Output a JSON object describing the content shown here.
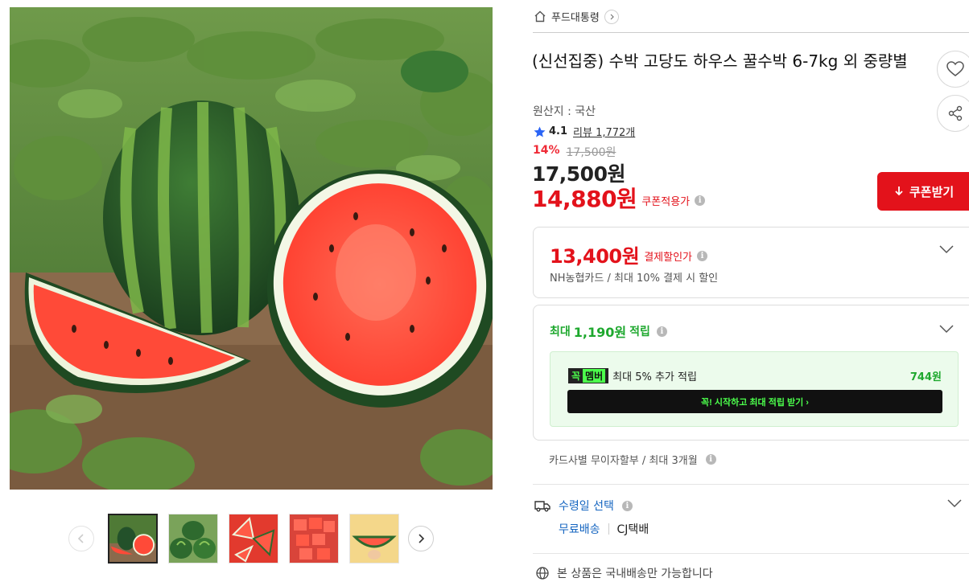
{
  "breadcrumb": {
    "category": "푸드대통령"
  },
  "product": {
    "title": "(신선집중) 수박 고당도 하우스 꿀수박 6-7kg 외 중량별",
    "origin": "원산지 : 국산",
    "rating": "4.1",
    "reviews": "리뷰 1,772개"
  },
  "price": {
    "discount_rate": "14%",
    "original": "17,500원",
    "sale": "17,500원",
    "coupon_price": "14,880원",
    "coupon_label": "쿠폰적용가"
  },
  "coupon_button": {
    "label": "쿠폰받기"
  },
  "payment_box": {
    "amount": "13,400원",
    "label": "결제할인가",
    "note": "NH농협카드 / 최대 10% 결제 시 할인"
  },
  "points_box": {
    "prefix": "최대",
    "amount": "1,190원",
    "suffix": "적립",
    "badge_1": "꼭",
    "badge_2": "멤버",
    "member_text": "최대 5% 추가 적립",
    "member_points": "744원",
    "member_cta": "꼭! 시작하고 최대 적립 받기 ›"
  },
  "installment": "카드사별 무이자할부 / 최대 3개월",
  "delivery": {
    "label": "수령일 선택",
    "free": "무료배송",
    "carrier": "CJ택배"
  },
  "domestic_note": "본 상품은 국내배송만 가능합니다",
  "colors": {
    "accent_red": "#e3121b",
    "green": "#1ea82e",
    "member_green": "#4cff4c",
    "link_blue": "#1565c0"
  },
  "thumbnails": [
    {
      "name": "thumb-watermelon-field"
    },
    {
      "name": "thumb-watermelon-pile"
    },
    {
      "name": "thumb-watermelon-slices"
    },
    {
      "name": "thumb-watermelon-cubes"
    },
    {
      "name": "thumb-watermelon-hand"
    }
  ]
}
